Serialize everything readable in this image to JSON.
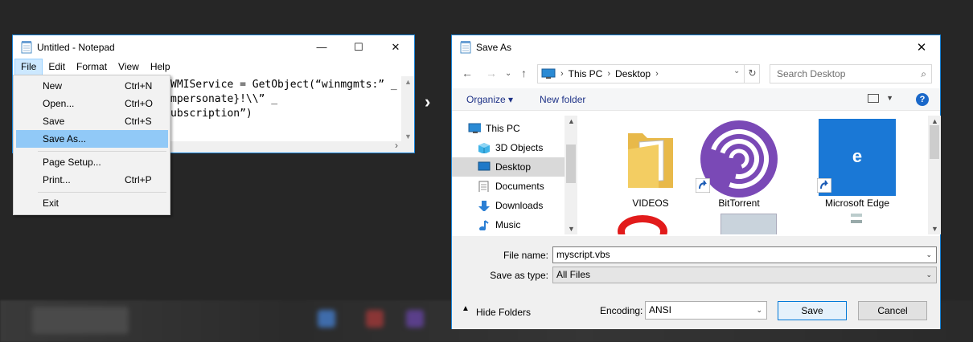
{
  "notepad": {
    "title": "Untitled - Notepad",
    "window_buttons": [
      "—",
      "☐",
      "✕"
    ],
    "menu": [
      "File",
      "Edit",
      "Format",
      "View",
      "Help"
    ],
    "text_lines": [
      "WMIService = GetObject(“winmgmts:” _",
      "mpersonate}!\\\\” _",
      "ubscription”)"
    ]
  },
  "file_menu": {
    "items": [
      {
        "label": "New",
        "shortcut": "Ctrl+N"
      },
      {
        "label": "Open...",
        "shortcut": "Ctrl+O"
      },
      {
        "label": "Save",
        "shortcut": "Ctrl+S"
      },
      {
        "label": "Save As...",
        "shortcut": ""
      },
      {
        "label": "Page Setup...",
        "shortcut": ""
      },
      {
        "label": "Print...",
        "shortcut": "Ctrl+P"
      },
      {
        "label": "Exit",
        "shortcut": ""
      }
    ]
  },
  "save_as": {
    "title": "Save As",
    "close": "✕",
    "address": {
      "root": "This PC",
      "folder": "Desktop"
    },
    "search_placeholder": "Search Desktop",
    "toolbar": {
      "organize": "Organize ▾",
      "new_folder": "New folder",
      "help": "?"
    },
    "nav_items": [
      {
        "label": "This PC",
        "icon": "pc-icon"
      },
      {
        "label": "3D Objects",
        "icon": "cube-icon"
      },
      {
        "label": "Desktop",
        "icon": "desktop-icon",
        "selected": true
      },
      {
        "label": "Documents",
        "icon": "documents-icon"
      },
      {
        "label": "Downloads",
        "icon": "download-icon"
      },
      {
        "label": "Music",
        "icon": "music-icon"
      }
    ],
    "files": [
      {
        "label": "VIDEOS",
        "icon": "folder-icon"
      },
      {
        "label": "BitTorrent",
        "icon": "bittorrent-icon"
      },
      {
        "label": "Microsoft Edge",
        "icon": "edge-icon"
      }
    ],
    "file_name_label": "File name:",
    "file_name_value": "myscript.vbs",
    "save_type_label": "Save as type:",
    "save_type_value": "All Files",
    "hide_folders": "Hide Folders",
    "encoding_label": "Encoding:",
    "encoding_value": "ANSI",
    "save_button": "Save",
    "cancel_button": "Cancel"
  },
  "colors": {
    "accent": "#1883d7",
    "menu_highlight": "#91c9f7",
    "edge_blue": "#1a78d6",
    "bittorrent_purple": "#7a49b6"
  }
}
